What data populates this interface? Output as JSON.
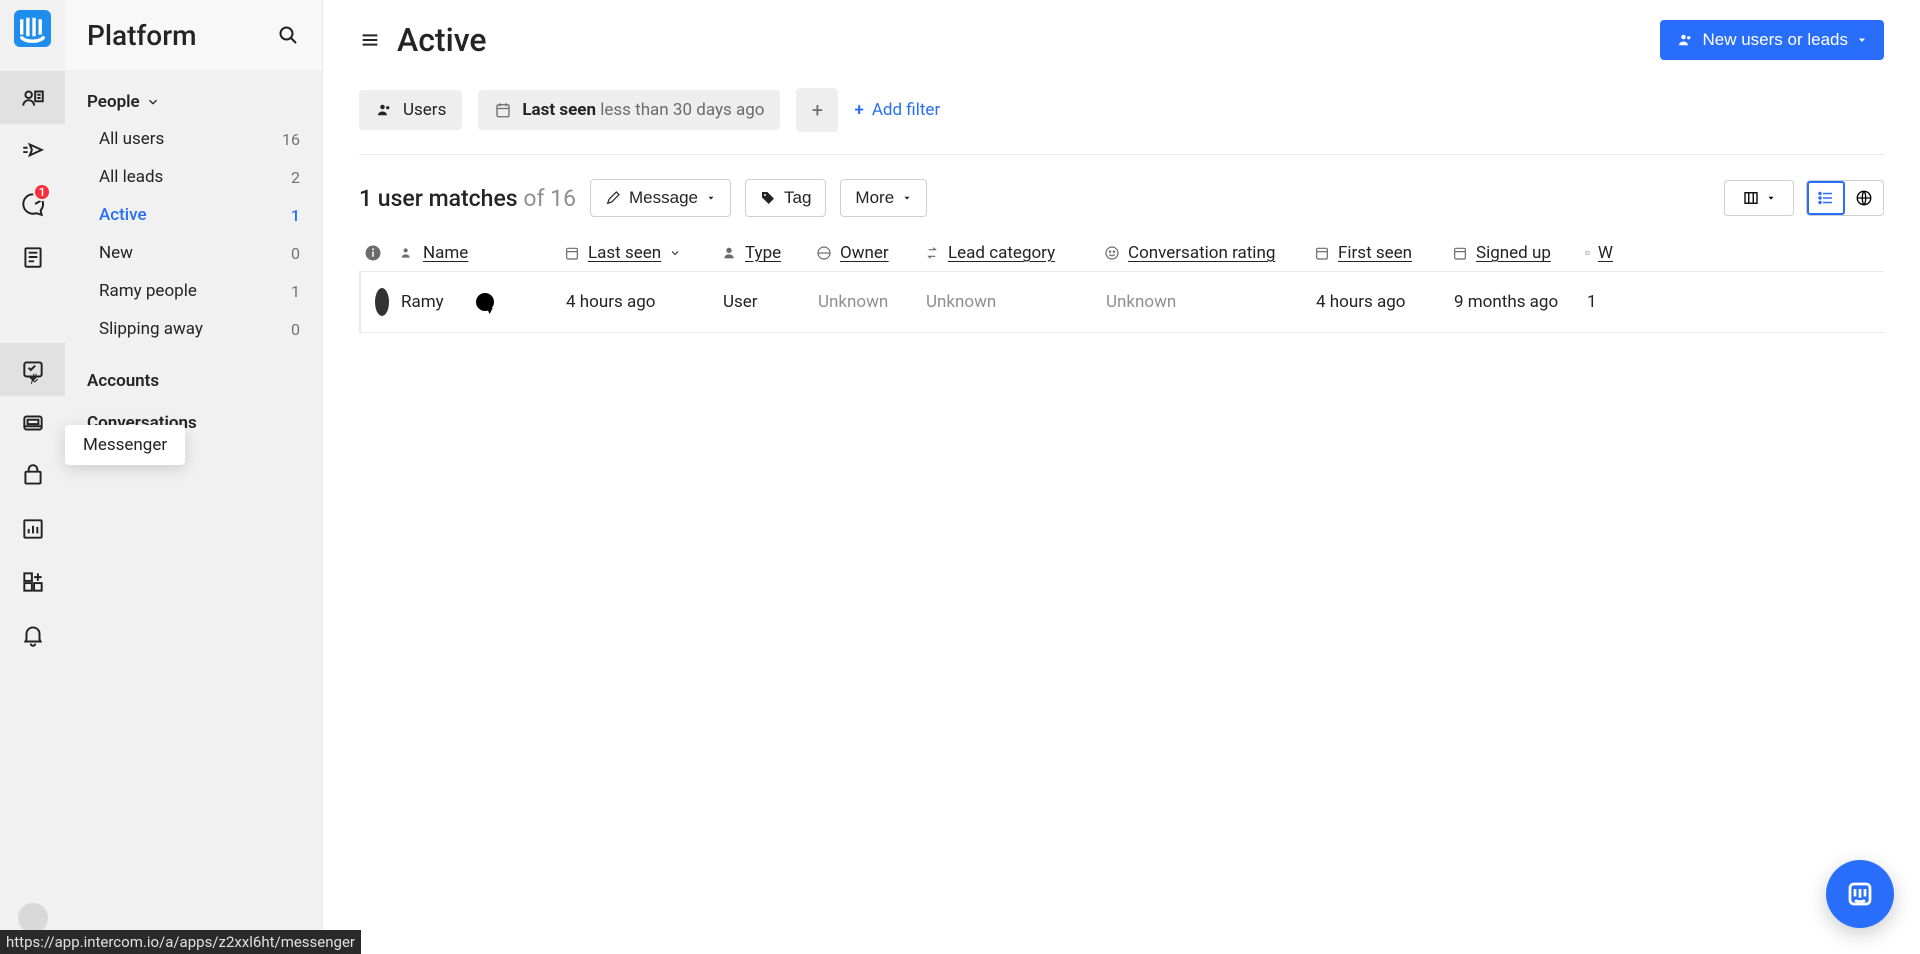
{
  "app_name": "Platform",
  "rail": {
    "badge_count": "1",
    "tooltip": "Messenger"
  },
  "sidebar": {
    "section": "People",
    "items": [
      {
        "label": "All users",
        "count": "16",
        "sel": false
      },
      {
        "label": "All leads",
        "count": "2",
        "sel": false
      },
      {
        "label": "Active",
        "count": "1",
        "sel": true
      },
      {
        "label": "New",
        "count": "0",
        "sel": false
      },
      {
        "label": "Ramy people",
        "count": "1",
        "sel": false
      },
      {
        "label": "Slipping away",
        "count": "0",
        "sel": false
      }
    ],
    "categories": [
      "Accounts",
      "Conversations"
    ]
  },
  "page": {
    "title": "Active",
    "cta": "New users or leads"
  },
  "filters": {
    "chip_users": "Users",
    "chip_lastseen_bold": "Last seen",
    "chip_lastseen_rest": "less than 30 days ago",
    "add_filter": "Add filter"
  },
  "toolbar": {
    "matches_pre": "1 user matches",
    "matches_of": "of 16",
    "message": "Message",
    "tag": "Tag",
    "more": "More"
  },
  "table": {
    "headers": {
      "name": "Name",
      "last_seen": "Last seen",
      "type": "Type",
      "owner": "Owner",
      "lead": "Lead category",
      "conv": "Conversation rating",
      "first": "First seen",
      "signed": "Signed up",
      "w": "W"
    },
    "row": {
      "name": "Ramy",
      "last_seen": "4 hours ago",
      "type": "User",
      "owner": "Unknown",
      "lead": "Unknown",
      "conv": "Unknown",
      "first": "4 hours ago",
      "signed": "9 months ago",
      "w": "1"
    }
  },
  "status_url": "https://app.intercom.io/a/apps/z2xxl6ht/messenger"
}
